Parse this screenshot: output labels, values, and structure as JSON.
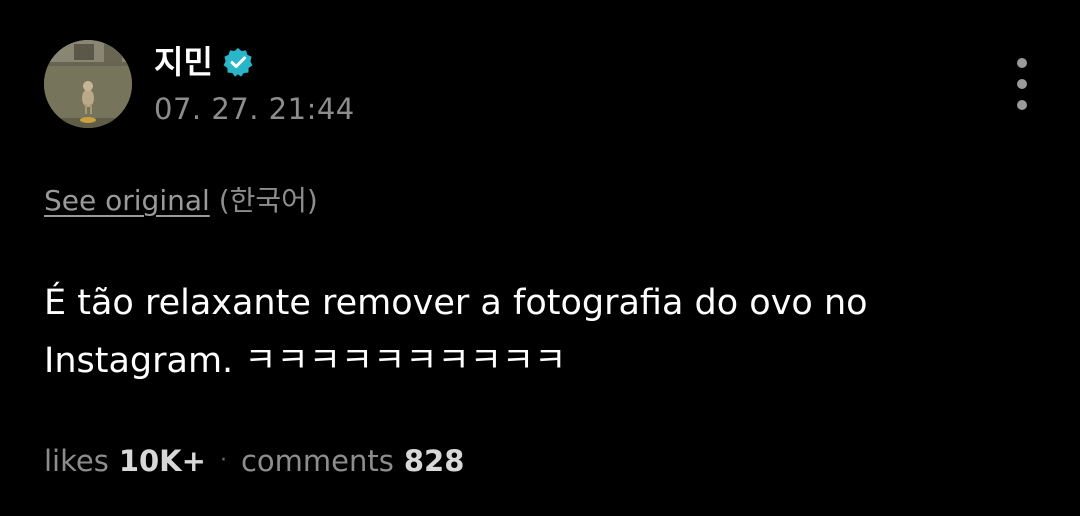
{
  "post": {
    "author": {
      "name": "지민",
      "verified": true,
      "verified_color": "#29b6c9"
    },
    "timestamp": "07. 27. 21:44",
    "menu_icon": "more-vertical-icon",
    "translation": {
      "see_original_label": "See original",
      "language": "(한국어)"
    },
    "body": {
      "line1": "É tão relaxante remover a fotografia do ovo no",
      "line2": "Instagram. ㅋㅋㅋㅋㅋㅋㅋㅋㅋㅋ"
    },
    "stats": {
      "likes_label": "likes",
      "likes_value": "10K+",
      "separator": "·",
      "comments_label": "comments",
      "comments_value": "828"
    }
  },
  "colors": {
    "background": "#000000",
    "text_primary": "#ffffff",
    "text_secondary": "#8d8d8d"
  }
}
